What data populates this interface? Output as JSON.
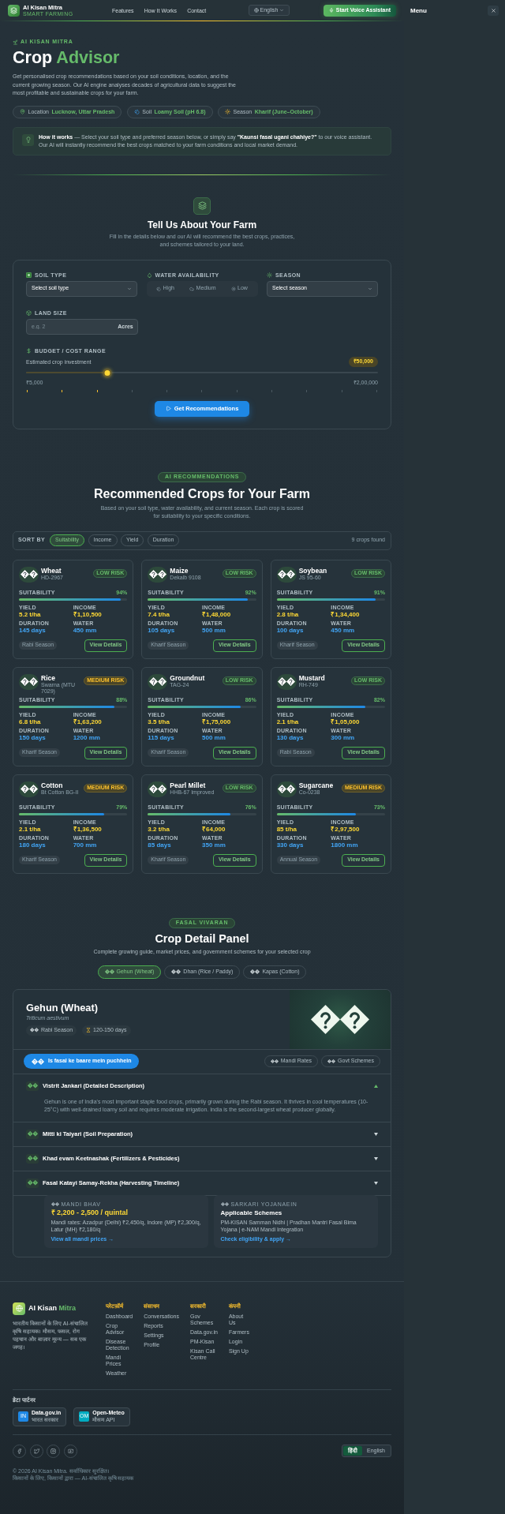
{
  "header": {
    "brand": "AI Kisan Mitra",
    "tagline": "SMART FARMING",
    "nav": [
      "Features",
      "How It Works",
      "Contact"
    ],
    "language": "English",
    "voice_button": "Start Voice Assistant"
  },
  "drawer": {
    "title": "Menu"
  },
  "hero": {
    "eyebrow": "AI KISAN MITRA",
    "title": "Crop",
    "title_highlight": "Advisor",
    "description": "Get personalised crop recommendations based on your soil conditions, location, and the current growing season. Our AI engine analyses decades of agricultural data to suggest the most profitable and sustainable crops for your farm.",
    "context": [
      {
        "kind": "location",
        "label": "Location",
        "value": "Lucknow, Uttar Pradesh"
      },
      {
        "kind": "soil",
        "label": "Soil",
        "value": "Loamy Soil (pH 6.8)"
      },
      {
        "kind": "season",
        "label": "Season",
        "value": "Kharif (June–October)"
      }
    ],
    "how_it_works": "**How it works** — Select your soil type and preferred season below, or simply say **\"Kaunsi fasal ugani chahiye?\"** to our voice assistant. Our AI will instantly recommend the best crops matched to your farm conditions and local market demand."
  },
  "farm_form": {
    "title": "Tell Us About Your Farm",
    "subtitle": "Fill in the details below and our AI will recommend the best crops, practices, and schemes tailored to your land.",
    "soil_type": {
      "label": "SOIL TYPE",
      "placeholder": "Select soil type"
    },
    "water": {
      "label": "WATER AVAILABILITY",
      "options": [
        {
          "label": "High",
          "selected": false
        },
        {
          "label": "Medium",
          "selected": false
        },
        {
          "label": "Low",
          "selected": false
        }
      ]
    },
    "season": {
      "label": "SEASON",
      "placeholder": "Select season"
    },
    "land_size": {
      "label": "LAND SIZE",
      "placeholder": "e.g. 2",
      "unit": "Acres"
    },
    "budget": {
      "label": "BUDGET / COST RANGE",
      "hint": "Estimated crop investment",
      "value": "₹50,000",
      "level": 0.23,
      "min": "₹5,000",
      "max": "₹2,00,000"
    },
    "submit": "Get Recommendations"
  },
  "recommendations": {
    "badge": "AI RECOMMENDATIONS",
    "title": "Recommended Crops for Your Farm",
    "subtitle": "Based on your soil type, water availability, and current season. Each crop is scored for suitability to your specific conditions.",
    "sort_label": "SORT BY",
    "sort_options": [
      {
        "label": "Suitability",
        "selected": true
      },
      {
        "label": "Income",
        "selected": false
      },
      {
        "label": "Yield",
        "selected": false
      },
      {
        "label": "Duration",
        "selected": false
      }
    ],
    "count": "9 crops found",
    "crops": [
      {
        "name": "Wheat",
        "variety": "HD-2967",
        "risk": {
          "kind": "low",
          "label": "LOW RISK"
        },
        "suitability_label": "SUITABILITY",
        "suitability": "94%",
        "level": 0.94,
        "stats": [
          {
            "kind": "yield",
            "label": "YIELD",
            "value": "5.2 t/ha"
          },
          {
            "kind": "income",
            "label": "INCOME",
            "value": "₹1,10,500"
          },
          {
            "kind": "duration",
            "label": "DURATION",
            "value": "145 days"
          },
          {
            "kind": "water",
            "label": "WATER",
            "value": "450 mm"
          }
        ],
        "season": "Rabi Season",
        "action": "View Details"
      },
      {
        "name": "Maize",
        "variety": "Dekalb 9108",
        "risk": {
          "kind": "low",
          "label": "LOW RISK"
        },
        "suitability_label": "SUITABILITY",
        "suitability": "92%",
        "level": 0.92,
        "stats": [
          {
            "kind": "yield",
            "label": "YIELD",
            "value": "7.4 t/ha"
          },
          {
            "kind": "income",
            "label": "INCOME",
            "value": "₹1,48,000"
          },
          {
            "kind": "duration",
            "label": "DURATION",
            "value": "105 days"
          },
          {
            "kind": "water",
            "label": "WATER",
            "value": "500 mm"
          }
        ],
        "season": "Kharif Season",
        "action": "View Details"
      },
      {
        "name": "Soybean",
        "variety": "JS 95-60",
        "risk": {
          "kind": "low",
          "label": "LOW RISK"
        },
        "suitability_label": "SUITABILITY",
        "suitability": "91%",
        "level": 0.91,
        "stats": [
          {
            "kind": "yield",
            "label": "YIELD",
            "value": "2.8 t/ha"
          },
          {
            "kind": "income",
            "label": "INCOME",
            "value": "₹1,34,400"
          },
          {
            "kind": "duration",
            "label": "DURATION",
            "value": "100 days"
          },
          {
            "kind": "water",
            "label": "WATER",
            "value": "450 mm"
          }
        ],
        "season": "Kharif Season",
        "action": "View Details"
      },
      {
        "name": "Rice",
        "variety": "Swarna (MTU 7029)",
        "risk": {
          "kind": "medium",
          "label": "MEDIUM RISK"
        },
        "suitability_label": "SUITABILITY",
        "suitability": "88%",
        "level": 0.88,
        "stats": [
          {
            "kind": "yield",
            "label": "YIELD",
            "value": "6.8 t/ha"
          },
          {
            "kind": "income",
            "label": "INCOME",
            "value": "₹1,63,200"
          },
          {
            "kind": "duration",
            "label": "DURATION",
            "value": "150 days"
          },
          {
            "kind": "water",
            "label": "WATER",
            "value": "1200 mm"
          }
        ],
        "season": "Kharif Season",
        "action": "View Details"
      },
      {
        "name": "Groundnut",
        "variety": "TAG-24",
        "risk": {
          "kind": "low",
          "label": "LOW RISK"
        },
        "suitability_label": "SUITABILITY",
        "suitability": "86%",
        "level": 0.86,
        "stats": [
          {
            "kind": "yield",
            "label": "YIELD",
            "value": "3.5 t/ha"
          },
          {
            "kind": "income",
            "label": "INCOME",
            "value": "₹1,75,000"
          },
          {
            "kind": "duration",
            "label": "DURATION",
            "value": "115 days"
          },
          {
            "kind": "water",
            "label": "WATER",
            "value": "500 mm"
          }
        ],
        "season": "Kharif Season",
        "action": "View Details"
      },
      {
        "name": "Mustard",
        "variety": "RH-749",
        "risk": {
          "kind": "low",
          "label": "LOW RISK"
        },
        "suitability_label": "SUITABILITY",
        "suitability": "82%",
        "level": 0.82,
        "stats": [
          {
            "kind": "yield",
            "label": "YIELD",
            "value": "2.1 t/ha"
          },
          {
            "kind": "income",
            "label": "INCOME",
            "value": "₹1,05,000"
          },
          {
            "kind": "duration",
            "label": "DURATION",
            "value": "130 days"
          },
          {
            "kind": "water",
            "label": "WATER",
            "value": "300 mm"
          }
        ],
        "season": "Rabi Season",
        "action": "View Details"
      },
      {
        "name": "Cotton",
        "variety": "Bt Cotton BG-II",
        "risk": {
          "kind": "medium",
          "label": "MEDIUM RISK"
        },
        "suitability_label": "SUITABILITY",
        "suitability": "79%",
        "level": 0.79,
        "stats": [
          {
            "kind": "yield",
            "label": "YIELD",
            "value": "2.1 t/ha"
          },
          {
            "kind": "income",
            "label": "INCOME",
            "value": "₹1,36,500"
          },
          {
            "kind": "duration",
            "label": "DURATION",
            "value": "180 days"
          },
          {
            "kind": "water",
            "label": "WATER",
            "value": "700 mm"
          }
        ],
        "season": "Kharif Season",
        "action": "View Details"
      },
      {
        "name": "Pearl Millet",
        "variety": "HHB-67 Improved",
        "risk": {
          "kind": "low",
          "label": "LOW RISK"
        },
        "suitability_label": "SUITABILITY",
        "suitability": "76%",
        "level": 0.76,
        "stats": [
          {
            "kind": "yield",
            "label": "YIELD",
            "value": "3.2 t/ha"
          },
          {
            "kind": "income",
            "label": "INCOME",
            "value": "₹64,000"
          },
          {
            "kind": "duration",
            "label": "DURATION",
            "value": "85 days"
          },
          {
            "kind": "water",
            "label": "WATER",
            "value": "350 mm"
          }
        ],
        "season": "Kharif Season",
        "action": "View Details"
      },
      {
        "name": "Sugarcane",
        "variety": "Co-0238",
        "risk": {
          "kind": "medium",
          "label": "MEDIUM RISK"
        },
        "suitability_label": "SUITABILITY",
        "suitability": "73%",
        "level": 0.73,
        "stats": [
          {
            "kind": "yield",
            "label": "YIELD",
            "value": "85 t/ha"
          },
          {
            "kind": "income",
            "label": "INCOME",
            "value": "₹2,97,500"
          },
          {
            "kind": "duration",
            "label": "DURATION",
            "value": "330 days"
          },
          {
            "kind": "water",
            "label": "WATER",
            "value": "1800 mm"
          }
        ],
        "season": "Annual Season",
        "action": "View Details"
      }
    ]
  },
  "crop_detail": {
    "badge": "FASAL VIVARAN",
    "title": "Crop Detail Panel",
    "subtitle": "Complete growing guide, market prices, and government schemes for your selected crop",
    "tabs": [
      {
        "label": "Gehun (Wheat)",
        "selected": true
      },
      {
        "label": "Dhan (Rice / Paddy)",
        "selected": false
      },
      {
        "label": "Kapas (Cotton)",
        "selected": false
      }
    ],
    "crop": {
      "name": "Gehun (Wheat)",
      "scientific_name": "Triticum aestivum",
      "tags": [
        {
          "kind": "season",
          "label": "Rabi Season"
        },
        {
          "kind": "duration",
          "label": "120-150 days"
        }
      ]
    },
    "ask_button": "Is fasal ke baare mein puchhein",
    "quick_links": [
      "Mandi Rates",
      "Govt Schemes"
    ],
    "sections": [
      {
        "title": "Vistrit Jankari (Detailed Description)",
        "expanded": true,
        "body": "Gehun is one of India's most important staple food crops, primarily grown during the Rabi season. It thrives in cool temperatures (10-25°C) with well-drained loamy soil and requires moderate irrigation. India is the second-largest wheat producer globally."
      },
      {
        "title": "Mitti ki Taiyari (Soil Preparation)",
        "expanded": false
      },
      {
        "title": "Khad evam Keetnashak (Fertilizers & Pesticides)",
        "expanded": false
      },
      {
        "title": "Fasal Katayi Samay-Rekha (Harvesting Timeline)",
        "expanded": false
      }
    ],
    "info_cards": [
      {
        "kind": "price",
        "label": "MANDI BHAV",
        "headline": "₹ 2,200 - 2,500 / quintal",
        "text": "Mandi rates: Azadpur (Delhi) ₹2,450/q, Indore (MP) ₹2,300/q, Latur (MH) ₹2,180/q",
        "link": "View all mandi prices →"
      },
      {
        "kind": "schemes",
        "label": "SARKARI YOJANAEIN",
        "headline": "Applicable Schemes",
        "text": "PM-KISAN Samman Nidhi | Pradhan Mantri Fasal Bima Yojana | e-NAM Mandi Integration",
        "link": "Check eligibility & apply →"
      }
    ]
  },
  "footer": {
    "brand": "AI Kisan",
    "brand_highlight": "Mitra",
    "description": "भारतीय किसानों के लिए AI-संचालित कृषि सहायक। मौसम, फसल, रोग पहचान और बाज़ार मूल्य — सब एक जगह।",
    "columns": [
      {
        "title": "प्लेटफ़ॉर्म",
        "links": [
          "Dashboard",
          "Crop Advisor",
          "Disease Detection",
          "Mandi Prices",
          "Weather"
        ]
      },
      {
        "title": "संसाधन",
        "links": [
          "Conversations",
          "Reports",
          "Settings",
          "Profile"
        ]
      },
      {
        "title": "सरकारी",
        "links": [
          "Gov Schemes",
          "Data.gov.in",
          "PM-Kisan",
          "Kisan Call Centre"
        ]
      },
      {
        "title": "कंपनी",
        "links": [
          "About Us",
          "Farmers",
          "Login",
          "Sign Up"
        ]
      }
    ],
    "partners_title": "डेटा पार्टनर",
    "partners": [
      {
        "badge": "IN",
        "name": "Data.gov.in",
        "caption": "भारत सरकार",
        "color": "#1e88e5"
      },
      {
        "badge": "OM",
        "name": "Open-Meteo",
        "caption": "मौसम API",
        "color": "#00acc1"
      }
    ],
    "languages": [
      {
        "label": "हिंदी",
        "selected": true
      },
      {
        "label": "English",
        "selected": false
      }
    ],
    "copyright": "© 2026 AI Kisan Mitra. सर्वाधिकार सुरक्षित।",
    "tagline": "किसानों के लिए, किसानों द्वारा — AI-संचालित कृषि सहायक"
  }
}
